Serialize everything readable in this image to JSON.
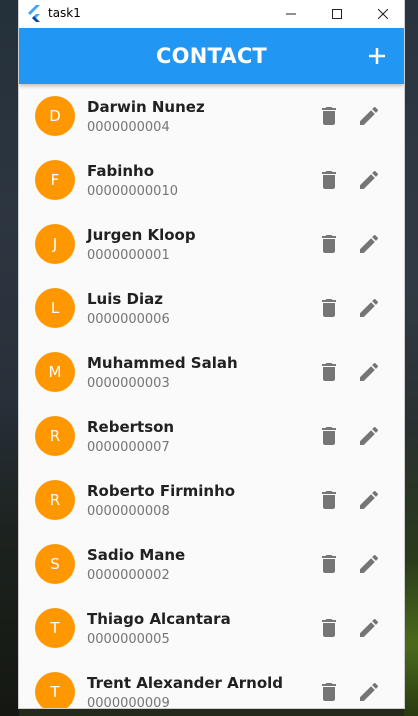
{
  "window": {
    "title": "task1"
  },
  "appbar": {
    "title": "CONTACT",
    "add_icon": "add-icon",
    "color": "#2196f3"
  },
  "avatar_color": "#ff9800",
  "contacts": [
    {
      "initial": "D",
      "name": "Darwin Nunez",
      "phone": "0000000004"
    },
    {
      "initial": "F",
      "name": "Fabinho",
      "phone": "00000000010"
    },
    {
      "initial": "J",
      "name": "Jurgen Kloop",
      "phone": "0000000001"
    },
    {
      "initial": "L",
      "name": "Luis Diaz",
      "phone": "0000000006"
    },
    {
      "initial": "M",
      "name": "Muhammed Salah",
      "phone": "0000000003"
    },
    {
      "initial": "R",
      "name": "Rebertson",
      "phone": "0000000007"
    },
    {
      "initial": "R",
      "name": "Roberto Firminho",
      "phone": "0000000008"
    },
    {
      "initial": "S",
      "name": "Sadio Mane",
      "phone": "0000000002"
    },
    {
      "initial": "T",
      "name": "Thiago Alcantara",
      "phone": "0000000005"
    },
    {
      "initial": "T",
      "name": "Trent Alexander Arnold",
      "phone": "0000000009"
    }
  ],
  "icons": {
    "delete": "delete-icon",
    "edit": "edit-icon"
  }
}
